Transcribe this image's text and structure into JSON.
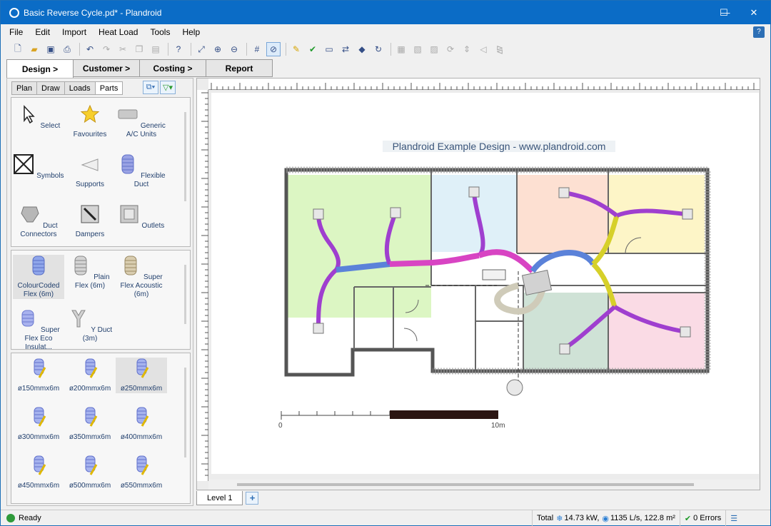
{
  "window": {
    "title": "Basic Reverse Cycle.pd* - Plandroid",
    "minimize_label": "—",
    "maximize_label": "☐",
    "close_label": "✕"
  },
  "menu": [
    "File",
    "Edit",
    "Import",
    "Heat Load",
    "Tools",
    "Help"
  ],
  "main_tabs": [
    "Design >",
    "Customer >",
    "Costing >",
    "Report"
  ],
  "sub_tabs": [
    "Plan",
    "Draw",
    "Loads",
    "Parts"
  ],
  "parts_group1": [
    {
      "label": "Select",
      "icon": "cursor-icon"
    },
    {
      "label": "Favourites",
      "icon": "star-icon"
    },
    {
      "label": "Generic A/C Units",
      "icon": "ac-unit-icon"
    },
    {
      "label": "Symbols",
      "icon": "symbols-icon"
    },
    {
      "label": "Supports",
      "icon": "supports-icon"
    },
    {
      "label": "Flexible Duct",
      "icon": "flexible-duct-icon"
    },
    {
      "label": "Duct Connectors",
      "icon": "duct-connector-icon"
    },
    {
      "label": "Dampers",
      "icon": "damper-icon"
    },
    {
      "label": "Outlets",
      "icon": "outlet-icon"
    }
  ],
  "parts_group2": [
    {
      "label": "ColourCoded Flex (6m)",
      "icon": "colourcoded-flex-icon"
    },
    {
      "label": "Plain Flex (6m)",
      "icon": "plain-flex-icon"
    },
    {
      "label": "Super Flex Acoustic (6m)",
      "icon": "acoustic-flex-icon"
    },
    {
      "label": "Super Flex Eco Insulat...",
      "icon": "eco-flex-icon"
    },
    {
      "label": "Y Duct (3m)",
      "icon": "y-duct-icon"
    }
  ],
  "parts_group3": [
    "ø150mmx6m",
    "ø200mmx6m",
    "ø250mmx6m",
    "ø300mmx6m",
    "ø350mmx6m",
    "ø400mmx6m",
    "ø450mmx6m",
    "ø500mmx6m",
    "ø550mmx6m"
  ],
  "canvas": {
    "title": "Plandroid Example Design - www.plandroid.com",
    "scale_start": "0",
    "scale_end": "10m"
  },
  "levels": [
    "Level 1"
  ],
  "status": {
    "ready": "Ready",
    "total": "Total",
    "heat": "14.73 kW,",
    "airflow": "1135 L/s, 122.8 m²",
    "errors": "0 Errors"
  },
  "colors": {
    "titlebar": "#0b6cc6",
    "room_green": "#dcf6c3",
    "room_blue": "#dff0f8",
    "room_orange": "#fde0d2",
    "room_yellow": "#fdf5c7",
    "room_teal": "#cfe2d6",
    "room_pink": "#fadbe5",
    "duct_purple": "#9f3fcf",
    "duct_blue": "#5b82d9",
    "duct_magenta": "#d844c3",
    "duct_yellow": "#d6d02a"
  }
}
